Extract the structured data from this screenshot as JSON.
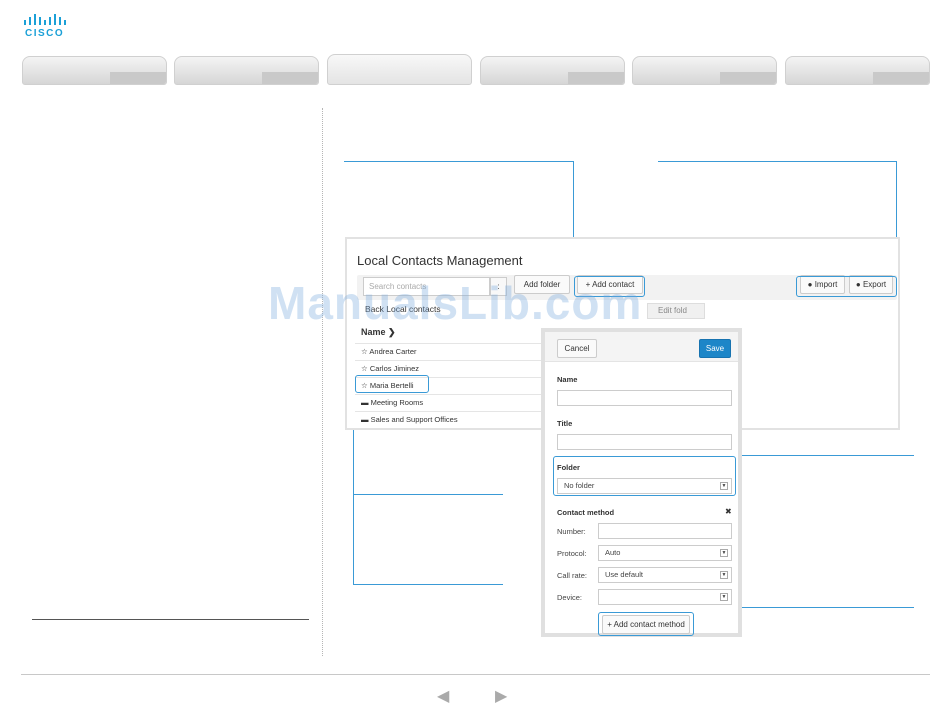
{
  "brand": {
    "logo_text": "CISCO",
    "accent": "#1ba0d7"
  },
  "nav": {
    "tabs": [
      "",
      "",
      "",
      "",
      "",
      ""
    ],
    "active_index": 2
  },
  "contacts_panel": {
    "title": "Local Contacts Management",
    "search_placeholder": "Search contacts",
    "search_button": ":",
    "add_folder_label": "Add folder",
    "add_contact_label": "+ Add contact",
    "import_label": "Import",
    "export_label": "Export",
    "breadcrumb": "Back  Local contacts",
    "edit_folder_label": "Edit fold",
    "column_header": "Name",
    "rows": [
      {
        "icon": "☆",
        "label": "Andrea Carter"
      },
      {
        "icon": "☆",
        "label": "Carlos Jiminez"
      },
      {
        "icon": "☆",
        "label": "Maria Bertelli"
      },
      {
        "icon": "▬",
        "label": "Meeting Rooms"
      },
      {
        "icon": "▬",
        "label": "Sales and Support Offices"
      }
    ]
  },
  "dialog": {
    "cancel_label": "Cancel",
    "save_label": "Save",
    "name_label": "Name",
    "name_value": "",
    "title_label": "Title",
    "title_value": "",
    "folder_label": "Folder",
    "folder_value": "No folder",
    "contact_method_label": "Contact method",
    "remove_icon": "✖",
    "number_label": "Number:",
    "number_value": "",
    "protocol_label": "Protocol:",
    "protocol_value": "Auto",
    "call_rate_label": "Call rate:",
    "call_rate_value": "Use default",
    "device_label": "Device:",
    "device_value": "",
    "add_method_label": "+ Add contact method"
  },
  "watermark": "ManualsLib.com",
  "footer": {
    "prev_icon": "◀",
    "next_icon": "▶"
  }
}
